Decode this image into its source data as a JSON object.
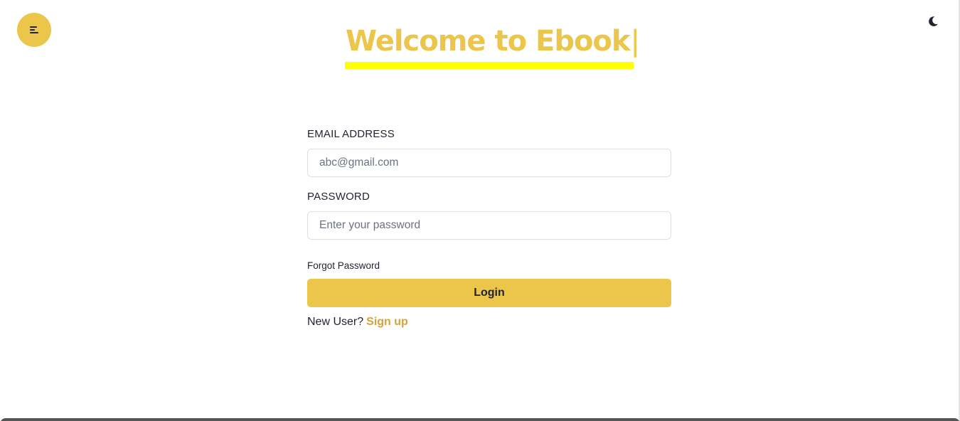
{
  "header": {
    "menu_icon": "menu-icon",
    "theme_icon": "moon-icon",
    "title": "Welcome to Ebook",
    "title_caret": "|"
  },
  "form": {
    "email_label": "EMAIL ADDRESS",
    "email_value": "",
    "email_placeholder": "abc@gmail.com",
    "password_label": "PASSWORD",
    "password_value": "",
    "password_placeholder": "Enter your password",
    "forgot_label": "Forgot Password",
    "login_label": "Login",
    "new_user_text": "New User?",
    "signup_label": "Sign up"
  },
  "colors": {
    "accent": "#ebc64a",
    "title_highlight": "#ffff00",
    "link": "#d4a23a",
    "text": "#1f2330"
  }
}
